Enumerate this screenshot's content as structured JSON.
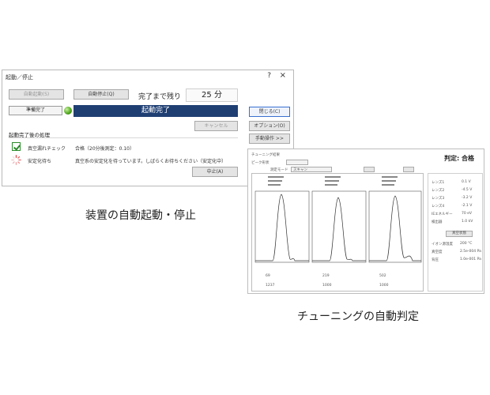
{
  "dialog1": {
    "title": "起動／停止",
    "help_glyph": "?",
    "close_glyph": "×",
    "buttons": {
      "auto_start": "自動起動(S)",
      "auto_stop": "自動停止(Q)",
      "close": "閉じる(C)",
      "cancel": "キャンセル",
      "options": "オプション(O)",
      "manual_ops": "手動操作 >>",
      "cancel_check": "中止(A)"
    },
    "remaining_label": "完了まで残り",
    "remaining_value": "25 分",
    "ready_label": "準備完了",
    "startup_status": "起動完了",
    "section_title": "起動完了後の処理",
    "tasks": [
      {
        "name": "真空漏れチェック",
        "result": "合格（20分後測定：0.10）",
        "state": "done"
      },
      {
        "name": "安定化待ち",
        "result": "真空系の安定化を待っています。しばらくお待ちください（安定化中）",
        "state": "running"
      }
    ]
  },
  "dialog2": {
    "title": "チューニング結果",
    "verdict": "判定: 合格",
    "tuning_file": "ピーク形状",
    "mode_label": "測定モード",
    "mode_value": "スキャン",
    "peaks": [
      {
        "mass": "69",
        "height": "1237"
      },
      {
        "mass": "219",
        "height": "1000"
      },
      {
        "mass": "502",
        "height": "1000"
      }
    ],
    "params": [
      {
        "label": "レンズ1",
        "value": "0.1 V"
      },
      {
        "label": "レンズ2",
        "value": "-4.5 V"
      },
      {
        "label": "レンズ3",
        "value": "-3.2 V"
      },
      {
        "label": "レンズ4",
        "value": "-2.1 V"
      },
      {
        "label": "IEエネルギー",
        "value": "70 eV"
      },
      {
        "label": "検出器",
        "value": "1.0 kV"
      }
    ],
    "vacuum_button": "真空状態",
    "vacuum": [
      {
        "label": "イオン源温度",
        "value": "200 °C"
      },
      {
        "label": "真空度",
        "value": "2.5e-004 Pa"
      },
      {
        "label": "背圧",
        "value": "1.0e-001 Pa"
      }
    ]
  },
  "captions": {
    "dialog1": "装置の自動起動・停止",
    "dialog2": "チューニングの自動判定"
  }
}
